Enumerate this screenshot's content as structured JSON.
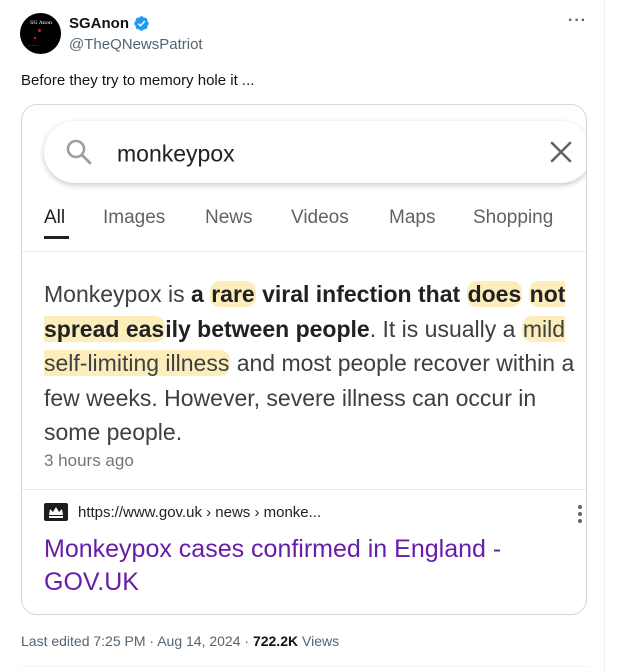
{
  "tweet": {
    "author_name": "SGAnon",
    "author_handle": "@TheQNewsPatriot",
    "text": "Before they try to memory hole it ...",
    "edited_label": "Last edited 7:25 PM · Aug 14, 2024",
    "separator": " · ",
    "views_count": "722.2K",
    "views_label": " Views",
    "more_icon": "ellipsis-icon",
    "verified_color": "#1d9bf0"
  },
  "screenshot": {
    "search_query": "monkeypox",
    "tabs": [
      {
        "label": "All",
        "active": true
      },
      {
        "label": "Images",
        "active": false
      },
      {
        "label": "News",
        "active": false
      },
      {
        "label": "Videos",
        "active": false
      },
      {
        "label": "Maps",
        "active": false
      },
      {
        "label": "Shopping",
        "active": false
      }
    ],
    "snippet": {
      "p1": "Monkeypox is ",
      "b1": "a ",
      "h1": "rare",
      "b2": " viral infection that ",
      "h2": "does",
      "h3": "not spread eas",
      "b3": "ily between people",
      "p2": ". It is usually a ",
      "h4": "mild self-limiting illness",
      "p3": " and most people recover within a few weeks. However, severe illness can occur in some people."
    },
    "time_ago": "3 hours ago",
    "result": {
      "url": "https://www.gov.uk › news › monke...",
      "title": "Monkeypox cases confirmed in England - GOV.UK"
    },
    "highlight_color": "#fade82",
    "link_color": "#681da8"
  }
}
